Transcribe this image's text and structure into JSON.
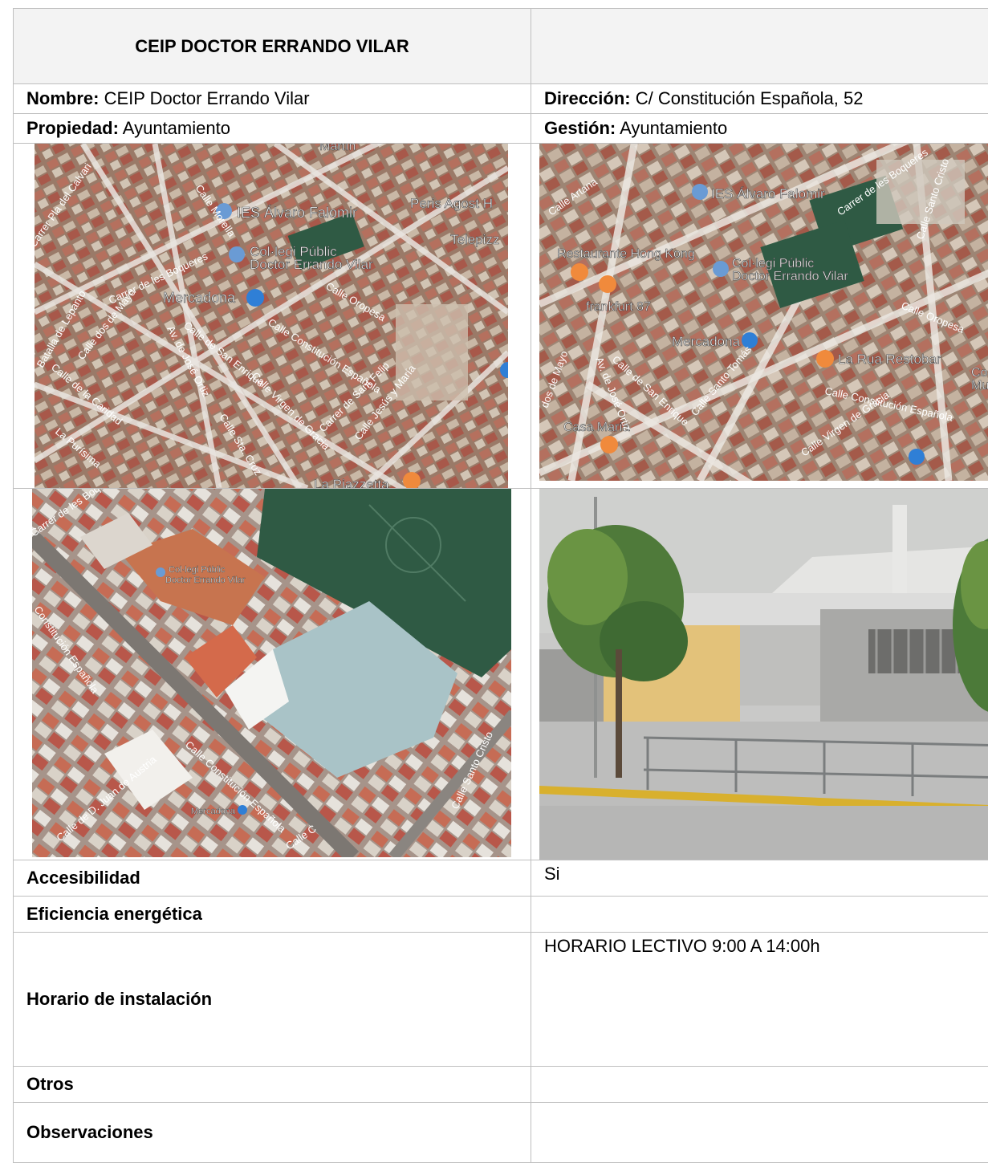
{
  "header": {
    "title": "CEIP DOCTOR ERRANDO VILAR"
  },
  "fields": {
    "nombre_label": "Nombre:",
    "nombre_value": " CEIP Doctor Errando Vilar",
    "direccion_label": "Dirección:",
    "direccion_value": " C/ Constitución Española, 52",
    "propiedad_label": "Propiedad:",
    "propiedad_value": " Ayuntamiento",
    "gestion_label": "Gestión:",
    "gestion_value": " Ayuntamiento"
  },
  "map1": {
    "labels": [
      "IES Álvaro Falomir",
      "Col·legi Públic",
      "Doctor Errando Vilar",
      "Mercadona",
      "Peris Agost H",
      "Telepizz",
      "La Piazzetta",
      "Martín"
    ],
    "streets": [
      "Carrer de les Boqueres",
      "Calle Morella",
      "Calle Oropesa",
      "Calle Constitución Española",
      "Calle de San Enrique",
      "Av. de José Ortiz",
      "Calle dos de Mayo",
      "Calle de la Caridad",
      "Calle Virgen de Gracia",
      "Carrer de Sant Felip",
      "Calle Jesús y María",
      "Calle Sta. Cruz",
      "Batalla de Lepanto",
      "La Purísima",
      "Carrer Pla del Calvari"
    ]
  },
  "map2": {
    "labels": [
      "IES Álvaro Falomir",
      "Restaurante Hong Kong",
      "Col·legi Públic",
      "Doctor Errando Vilar",
      "frankfurt 87",
      "Mercadona",
      "La Rua Restobar",
      "Casa María",
      "Co",
      "Mu"
    ],
    "streets": [
      "Calle Artana",
      "Carrer de les Boqueres",
      "Calle Santo Cristo",
      "Calle Oropesa",
      "Calle Constitución Española",
      "Calle de San Enrique",
      "Av. de José Ortiz",
      "Calle Santo Tomás",
      "Calle Virgen de Gracia",
      "dos de Mayo"
    ]
  },
  "map3": {
    "labels": [
      "Col·legi Públic",
      "Doctor Errando Vilar",
      "Mercadona"
    ],
    "streets": [
      "Carrer de les Boqueres",
      "Constitución Española",
      "Calle Constitución Española",
      "Calle Santo Cristo",
      "Calle de D. Juan de Austria",
      "Calle C"
    ]
  },
  "rows": {
    "accesibilidad_label": "Accesibilidad",
    "accesibilidad_value": "Si",
    "eficiencia_label": "Eficiencia energética",
    "eficiencia_value": "",
    "horario_label": "Horario de instalación",
    "horario_value": "HORARIO LECTIVO 9:00 A 14:00h",
    "otros_label": "Otros",
    "otros_value": "",
    "observaciones_label": "Observaciones",
    "observaciones_value": ""
  },
  "colors": {
    "header_bg": "#f3f3f3",
    "border": "#bfbfbf",
    "poi_orange": "#f08a3c",
    "poi_blue": "#2f7fd6",
    "pitch_green": "#2f5a44"
  }
}
